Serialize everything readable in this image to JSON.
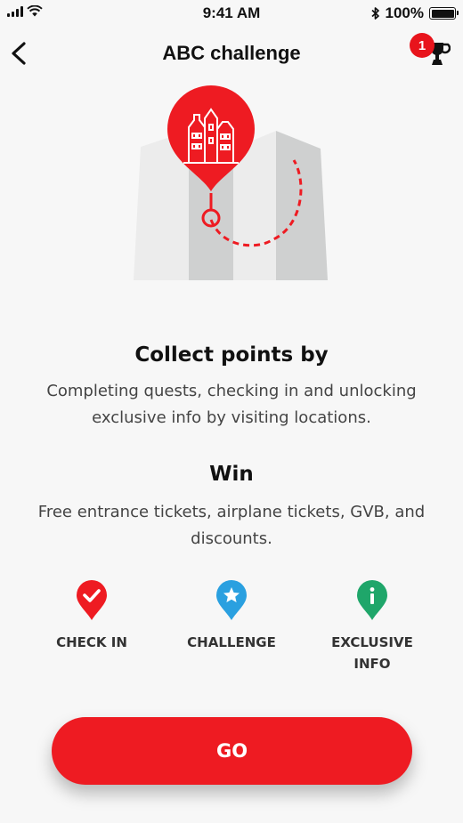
{
  "status_bar": {
    "time": "9:41 AM",
    "battery": "100%"
  },
  "header": {
    "title": "ABC challenge",
    "trophy_count": "1"
  },
  "collect": {
    "heading": "Collect points by",
    "text": "Completing quests, checking in and unlocking exclusive info by visiting locations."
  },
  "win": {
    "heading": "Win",
    "text": "Free entrance tickets, airplane tickets, GVB, and discounts."
  },
  "features": [
    {
      "label": "CHECK IN",
      "icon": "check-pin-icon",
      "color": "#ee1b22"
    },
    {
      "label": "CHALLENGE",
      "icon": "star-pin-icon",
      "color": "#2aa0e0"
    },
    {
      "label_line1": "EXCLUSIVE",
      "label_line2": "INFO",
      "icon": "info-pin-icon",
      "color": "#1fa66a"
    }
  ],
  "go_button": {
    "label": "GO"
  },
  "colors": {
    "accent": "#ee1b22",
    "background": "#f7f7f7"
  }
}
